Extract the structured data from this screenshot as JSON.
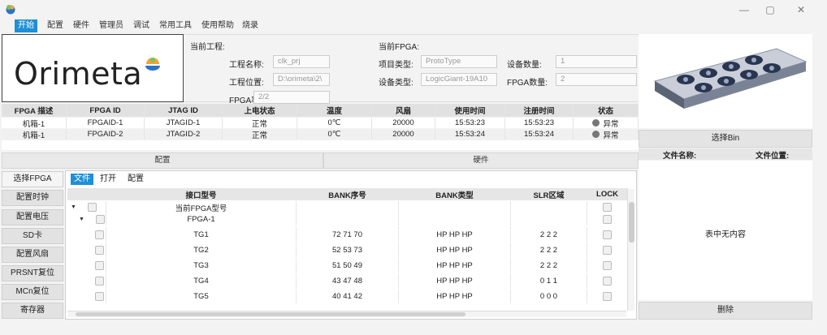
{
  "window": {
    "minimize": "—",
    "maximize": "▢",
    "close": "✕"
  },
  "menu": [
    "开始",
    "配置",
    "硬件",
    "管理员",
    "调试",
    "常用工具",
    "使用帮助",
    "烧录"
  ],
  "logo": {
    "text": "Orimeta",
    "accent": "#f2a13b",
    "accent2": "#2d72c4"
  },
  "project": {
    "current_label": "当前工程:",
    "name_label": "工程名称:",
    "name_value": "clk_prj",
    "path_label": "工程位置:",
    "path_value": "D:\\orimeta\\2\\",
    "fpga_rate_label": "FPGA率:",
    "fpga_rate_value": "2/2"
  },
  "fpga": {
    "current_label": "当前FPGA:",
    "type_label": "项目类型:",
    "type_value": "ProtoType",
    "device_label": "设备类型:",
    "device_value": "LogicGiant-19A10",
    "count_label": "设备数量:",
    "count_value": "1",
    "fpga_count_label": "FPGA数量:",
    "fpga_count_value": "2"
  },
  "fpga_table": {
    "headers": [
      "FPGA 描述",
      "FPGA ID",
      "JTAG ID",
      "上电状态",
      "温度",
      "风扇",
      "使用时间",
      "注册时间",
      "状态"
    ],
    "rows": [
      [
        "机箱-1",
        "FPGAID-1",
        "JTAGID-1",
        "正常",
        "0℃",
        "20000",
        "15:53:23",
        "15:53:23",
        "异常"
      ],
      [
        "机箱-1",
        "FPGAID-2",
        "JTAGID-2",
        "正常",
        "0℃",
        "20000",
        "15:53:24",
        "15:53:24",
        "异常"
      ]
    ]
  },
  "bin": {
    "select_label": "选择Bin",
    "col_name": "文件名称:",
    "col_path": "文件位置:",
    "empty_text": "表中无内容",
    "delete_label": "删除"
  },
  "sections": {
    "config": "配置",
    "hardware": "硬件"
  },
  "side_buttons": [
    "选择FPGA",
    "配置时钟",
    "配置电压",
    "SD卡",
    "配置风扇",
    "PRSNT复位",
    "MCn复位",
    "寄存器"
  ],
  "sub_tabs": [
    "文件",
    "打开",
    "配置"
  ],
  "grid": {
    "headers": [
      "接口型号",
      "BANK序号",
      "BANK类型",
      "SLR区域",
      "LOCK"
    ],
    "groups": [
      {
        "label": "当前FPGA型号"
      },
      {
        "label": "FPGA-1"
      }
    ],
    "rows": [
      [
        "TG1",
        "72 71 70",
        "HP HP HP",
        "2 2 2"
      ],
      [
        "TG2",
        "52 53 73",
        "HP HP HP",
        "2 2 2"
      ],
      [
        "TG3",
        "51 50 49",
        "HP HP HP",
        "2 2 2"
      ],
      [
        "TG4",
        "43 47 48",
        "HP HP HP",
        "0 1 1"
      ],
      [
        "TG5",
        "40 41 42",
        "HP HP HP",
        "0 0 0"
      ]
    ]
  },
  "colors": {
    "accent": "#1f8fd8"
  }
}
